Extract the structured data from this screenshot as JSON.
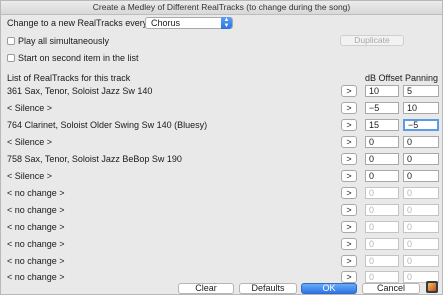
{
  "window": {
    "title": "Create a Medley of Different RealTracks (to change during the song)"
  },
  "change_label": "Change to a new RealTracks every",
  "change_select": {
    "value": "Chorus"
  },
  "play_all": {
    "label": "Play all simultaneously",
    "checked": false
  },
  "start_second": {
    "label": "Start on second item in the list",
    "checked": false
  },
  "duplicate_label": "Duplicate",
  "list_header": "List of RealTracks for this track",
  "col_db": "dB Offset",
  "col_pan": "Panning",
  "rows": [
    {
      "name": "361 Sax, Tenor, Soloist Jazz Sw 140",
      "go": ">",
      "db": "10",
      "pan": "5"
    },
    {
      "name": "< Silence >",
      "go": ">",
      "db": "−5",
      "pan": "10"
    },
    {
      "name": "764 Clarinet, Soloist Older Swing Sw 140 (Bluesy)",
      "go": ">",
      "db": "15",
      "pan": "−5"
    },
    {
      "name": "< Silence >",
      "go": ">",
      "db": "0",
      "pan": "0"
    },
    {
      "name": "758 Sax, Tenor, Soloist Jazz BeBop Sw 190",
      "go": ">",
      "db": "0",
      "pan": "0"
    },
    {
      "name": "< Silence >",
      "go": ">",
      "db": "0",
      "pan": "0"
    },
    {
      "name": "< no change >",
      "go": ">",
      "db": "0",
      "pan": "0"
    },
    {
      "name": "< no change >",
      "go": ">",
      "db": "0",
      "pan": "0"
    },
    {
      "name": "< no change >",
      "go": ">",
      "db": "0",
      "pan": "0"
    },
    {
      "name": "< no change >",
      "go": ">",
      "db": "0",
      "pan": "0"
    },
    {
      "name": "< no change >",
      "go": ">",
      "db": "0",
      "pan": "0"
    },
    {
      "name": "< no change >",
      "go": ">",
      "db": "0",
      "pan": "0"
    }
  ],
  "buttons": {
    "clear": "Clear",
    "defaults": "Defaults",
    "ok": "OK",
    "cancel": "Cancel"
  },
  "colors": {
    "accent": "#2e76e4",
    "focus": "#5b9be8"
  }
}
